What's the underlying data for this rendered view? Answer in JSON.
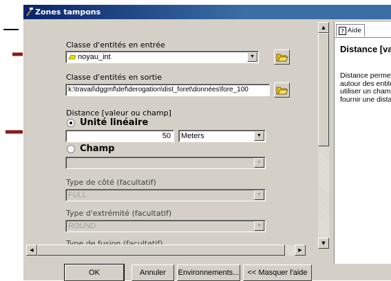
{
  "window": {
    "title": "Zones tampons"
  },
  "form": {
    "input_class": {
      "label": "Classe d'entités en entrée",
      "value": "noyau_int"
    },
    "output_class": {
      "label": "Classe d'entités en sortie",
      "value": "k:\\travail\\dggmf\\def\\derogation\\dist_foret\\données\\fore_100"
    },
    "distance": {
      "label": "Distance [valeur ou champ]",
      "linear_unit_option": "Unité linéaire",
      "value": "50",
      "unit": "Meters",
      "field_option": "Champ",
      "field_value": "",
      "selected": "Unité linéaire"
    },
    "side_type": {
      "label": "Type de côté (facultatif)",
      "value": "FULL"
    },
    "end_type": {
      "label": "Type d'extrémité (facultatif)",
      "value": "ROUND"
    },
    "dissolve_type": {
      "label": "Type de fusion (facultatif)"
    }
  },
  "help": {
    "tab_label": "Aide",
    "title": "Distance [vale",
    "lines": [
      "Distance permetta",
      "autour des entités",
      "utiliser un champ",
      "fournir une distanc"
    ]
  },
  "buttons": {
    "ok": "OK",
    "cancel": "Annuler",
    "environments": "Environnements...",
    "hide_help": "<< Masquer l'aide"
  },
  "colors": {
    "annotation_arrow": "#8b1a1a",
    "titlebar": "#0a246a"
  }
}
